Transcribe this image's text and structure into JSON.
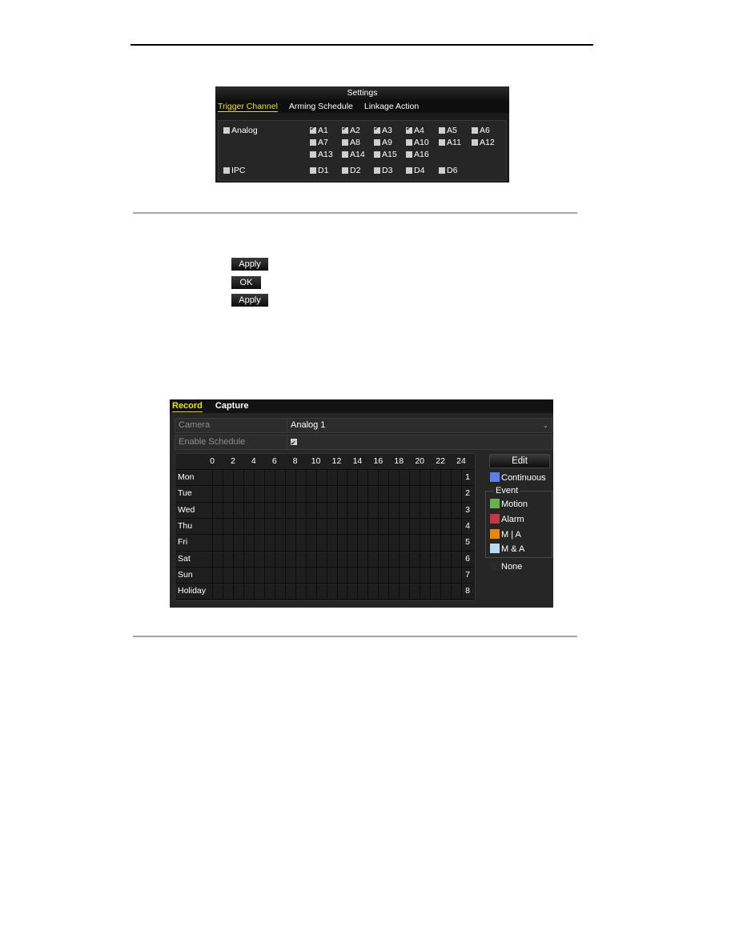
{
  "settings_panel": {
    "title": "Settings",
    "tabs": [
      {
        "label": "Trigger Channel",
        "active": true
      },
      {
        "label": "Arming Schedule",
        "active": false
      },
      {
        "label": "Linkage Action",
        "active": false
      }
    ],
    "groups": [
      {
        "label": "Analog",
        "checked": false,
        "channels": [
          {
            "label": "A1",
            "checked": true
          },
          {
            "label": "A2",
            "checked": true
          },
          {
            "label": "A3",
            "checked": true
          },
          {
            "label": "A4",
            "checked": true
          },
          {
            "label": "A5",
            "checked": false
          },
          {
            "label": "A6",
            "checked": false
          },
          {
            "label": "A7",
            "checked": false
          },
          {
            "label": "A8",
            "checked": false
          },
          {
            "label": "A9",
            "checked": false
          },
          {
            "label": "A10",
            "checked": false
          },
          {
            "label": "A11",
            "checked": false
          },
          {
            "label": "A12",
            "checked": false
          },
          {
            "label": "A13",
            "checked": false
          },
          {
            "label": "A14",
            "checked": false
          },
          {
            "label": "A15",
            "checked": false
          },
          {
            "label": "A16",
            "checked": false
          }
        ]
      },
      {
        "label": "IPC",
        "checked": false,
        "channels": [
          {
            "label": "D1",
            "checked": false
          },
          {
            "label": "D2",
            "checked": false
          },
          {
            "label": "D3",
            "checked": false
          },
          {
            "label": "D4",
            "checked": false
          },
          {
            "label": "D6",
            "checked": false
          }
        ]
      }
    ]
  },
  "inline_buttons": [
    {
      "label": "Apply"
    },
    {
      "label": "OK"
    },
    {
      "label": "Apply"
    }
  ],
  "record_panel": {
    "tabs": [
      {
        "label": "Record",
        "active": true
      },
      {
        "label": "Capture",
        "active": false
      }
    ],
    "camera_label": "Camera",
    "camera_value": "Analog 1",
    "enable_schedule_label": "Enable Schedule",
    "enable_schedule_checked": true,
    "hour_labels": [
      "0",
      "2",
      "4",
      "6",
      "8",
      "10",
      "12",
      "14",
      "16",
      "18",
      "20",
      "22",
      "24"
    ],
    "days": [
      "Mon",
      "Tue",
      "Wed",
      "Thu",
      "Fri",
      "Sat",
      "Sun",
      "Holiday"
    ],
    "row_numbers": [
      "1",
      "2",
      "3",
      "4",
      "5",
      "6",
      "7",
      "8"
    ],
    "edit_label": "Edit",
    "legend": {
      "continuous": {
        "label": "Continuous",
        "color": "#5b7ee8"
      },
      "event_title": "Event",
      "events": [
        {
          "label": "Motion",
          "color": "#6ab04c"
        },
        {
          "label": "Alarm",
          "color": "#c0393f"
        },
        {
          "label": "M | A",
          "color": "#e8860e"
        },
        {
          "label": "M & A",
          "color": "#b8dcf8"
        }
      ],
      "none": {
        "label": "None",
        "color": "#2a2a2a"
      }
    }
  },
  "colors": {
    "active_tab": "#e8e21a",
    "panel_bg": "#262626"
  }
}
